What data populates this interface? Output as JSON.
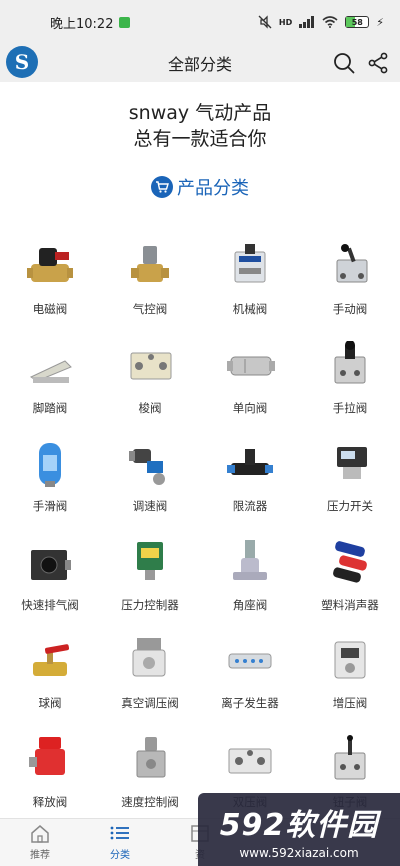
{
  "status_bar": {
    "time": "晚上10:22",
    "network": "HD",
    "battery": "58",
    "colors": {
      "app_icon": "#3bb54a",
      "battery_fill": "#5cc85c"
    }
  },
  "header": {
    "title": "全部分类",
    "logo_letter": "S"
  },
  "hero": {
    "line1": "snway 气动产品",
    "line2": "总有一款适合你"
  },
  "section": {
    "label": "产品分类",
    "accent": "#1a64b8"
  },
  "categories": [
    {
      "label": "电磁阀",
      "icon": "solenoid-valve"
    },
    {
      "label": "气控阀",
      "icon": "pneumatic-valve"
    },
    {
      "label": "机械阀",
      "icon": "mechanical-valve"
    },
    {
      "label": "手动阀",
      "icon": "manual-valve"
    },
    {
      "label": "脚踏阀",
      "icon": "foot-valve"
    },
    {
      "label": "梭阀",
      "icon": "shuttle-valve"
    },
    {
      "label": "单向阀",
      "icon": "check-valve"
    },
    {
      "label": "手拉阀",
      "icon": "pull-valve"
    },
    {
      "label": "手滑阀",
      "icon": "slide-valve"
    },
    {
      "label": "调速阀",
      "icon": "speed-valve"
    },
    {
      "label": "限流器",
      "icon": "flow-limiter"
    },
    {
      "label": "压力开关",
      "icon": "pressure-switch"
    },
    {
      "label": "快速排气阀",
      "icon": "exhaust-valve"
    },
    {
      "label": "压力控制器",
      "icon": "pressure-controller"
    },
    {
      "label": "角座阀",
      "icon": "angle-valve"
    },
    {
      "label": "塑料消声器",
      "icon": "silencer"
    },
    {
      "label": "球阀",
      "icon": "ball-valve"
    },
    {
      "label": "真空调压阀",
      "icon": "vacuum-regulator"
    },
    {
      "label": "离子发生器",
      "icon": "ionizer"
    },
    {
      "label": "增压阀",
      "icon": "booster-valve"
    },
    {
      "label": "释放阀",
      "icon": "release-valve"
    },
    {
      "label": "速度控制阀",
      "icon": "speed-control-valve"
    },
    {
      "label": "双压阀",
      "icon": "dual-pressure-valve"
    },
    {
      "label": "钮子阀",
      "icon": "toggle-valve"
    }
  ],
  "bottom_nav": [
    {
      "label": "推荐",
      "icon": "home-icon"
    },
    {
      "label": "分类",
      "icon": "list-icon",
      "active": true
    },
    {
      "label": "资",
      "icon": "book-icon"
    }
  ],
  "watermark": {
    "main": "592软件园",
    "url": "www.592xiazai.com"
  }
}
